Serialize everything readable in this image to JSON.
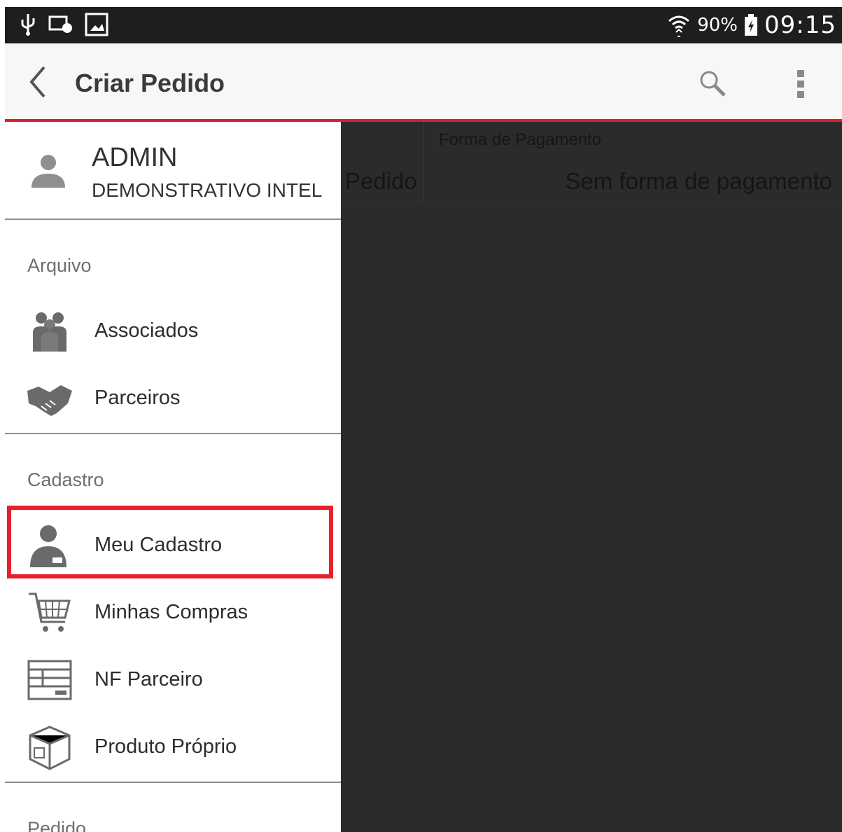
{
  "status_bar": {
    "battery_percent": "90%",
    "time": "09:15",
    "icons": [
      "usb-icon",
      "cast-icon",
      "image-icon",
      "wifi-icon",
      "battery-charging-icon"
    ]
  },
  "app_bar": {
    "title": "Criar Pedido",
    "icons": [
      "back-arrow-icon",
      "search-icon",
      "overflow-menu-icon"
    ]
  },
  "drawer": {
    "user": {
      "name": "ADMIN",
      "company": "DEMONSTRATIVO INTEL"
    },
    "sections": [
      {
        "label": "Arquivo",
        "items": [
          {
            "label": "Associados",
            "icon": "group-icon"
          },
          {
            "label": "Parceiros",
            "icon": "handshake-icon"
          }
        ]
      },
      {
        "label": "Cadastro",
        "items": [
          {
            "label": "Meu Cadastro",
            "icon": "user-profile-icon",
            "highlighted": true
          },
          {
            "label": "Minhas Compras",
            "icon": "shopping-cart-icon"
          },
          {
            "label": "NF Parceiro",
            "icon": "invoice-icon"
          },
          {
            "label": "Produto Próprio",
            "icon": "box-icon"
          }
        ]
      },
      {
        "label": "Pedido",
        "items": []
      }
    ]
  },
  "content": {
    "column_pedido": "Pedido",
    "forma_pagamento_label": "Forma de Pagamento",
    "forma_pagamento_value": "Sem forma de pagamento"
  },
  "colors": {
    "accent": "#d9202a",
    "highlight": "#e8202a",
    "overlay": "#2b2b2b",
    "status_bar": "#1e1e1e"
  }
}
